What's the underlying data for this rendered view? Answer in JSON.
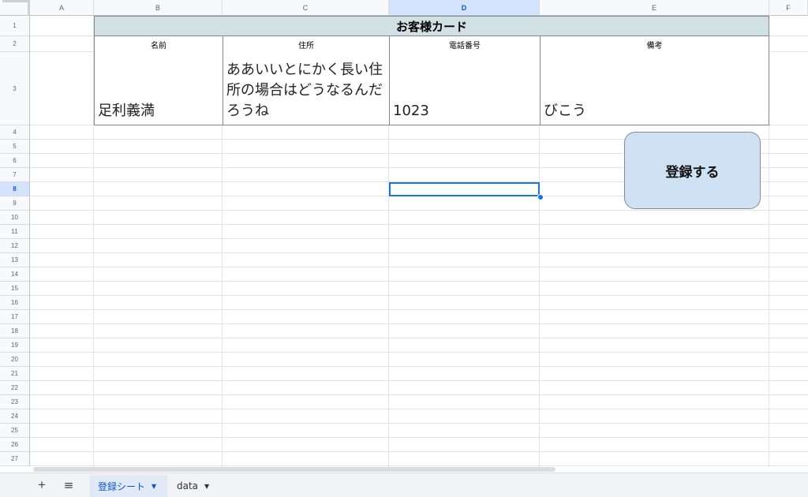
{
  "columns": [
    "A",
    "B",
    "C",
    "D",
    "E",
    "F"
  ],
  "selected_column": "D",
  "rows": [
    "1",
    "2",
    "3",
    "4",
    "5",
    "6",
    "7",
    "8",
    "9",
    "10",
    "11",
    "12",
    "13",
    "14",
    "15",
    "16",
    "17",
    "18",
    "19",
    "20",
    "21",
    "22",
    "23",
    "24",
    "25",
    "26",
    "27"
  ],
  "selected_row": "8",
  "sheet": {
    "title": "お客様カード",
    "headers": {
      "name": "名前",
      "address": "住所",
      "phone": "電話番号",
      "note": "備考"
    },
    "values": {
      "name": "足利義満",
      "address": "ああいいとにかく長い住所の場合はどうなるんだろうね",
      "phone": "1023",
      "note": "びこう"
    }
  },
  "button": {
    "label": "登録する",
    "color": "#cfe2f3"
  },
  "tabs": {
    "add_icon": "plus-icon",
    "menu_icon": "all-sheets-menu-icon",
    "items": [
      {
        "label": "登録シート",
        "active": true
      },
      {
        "label": "data",
        "active": false
      }
    ]
  },
  "colors": {
    "accent": "#1a73e8",
    "title_bg": "#d0e0e3"
  }
}
